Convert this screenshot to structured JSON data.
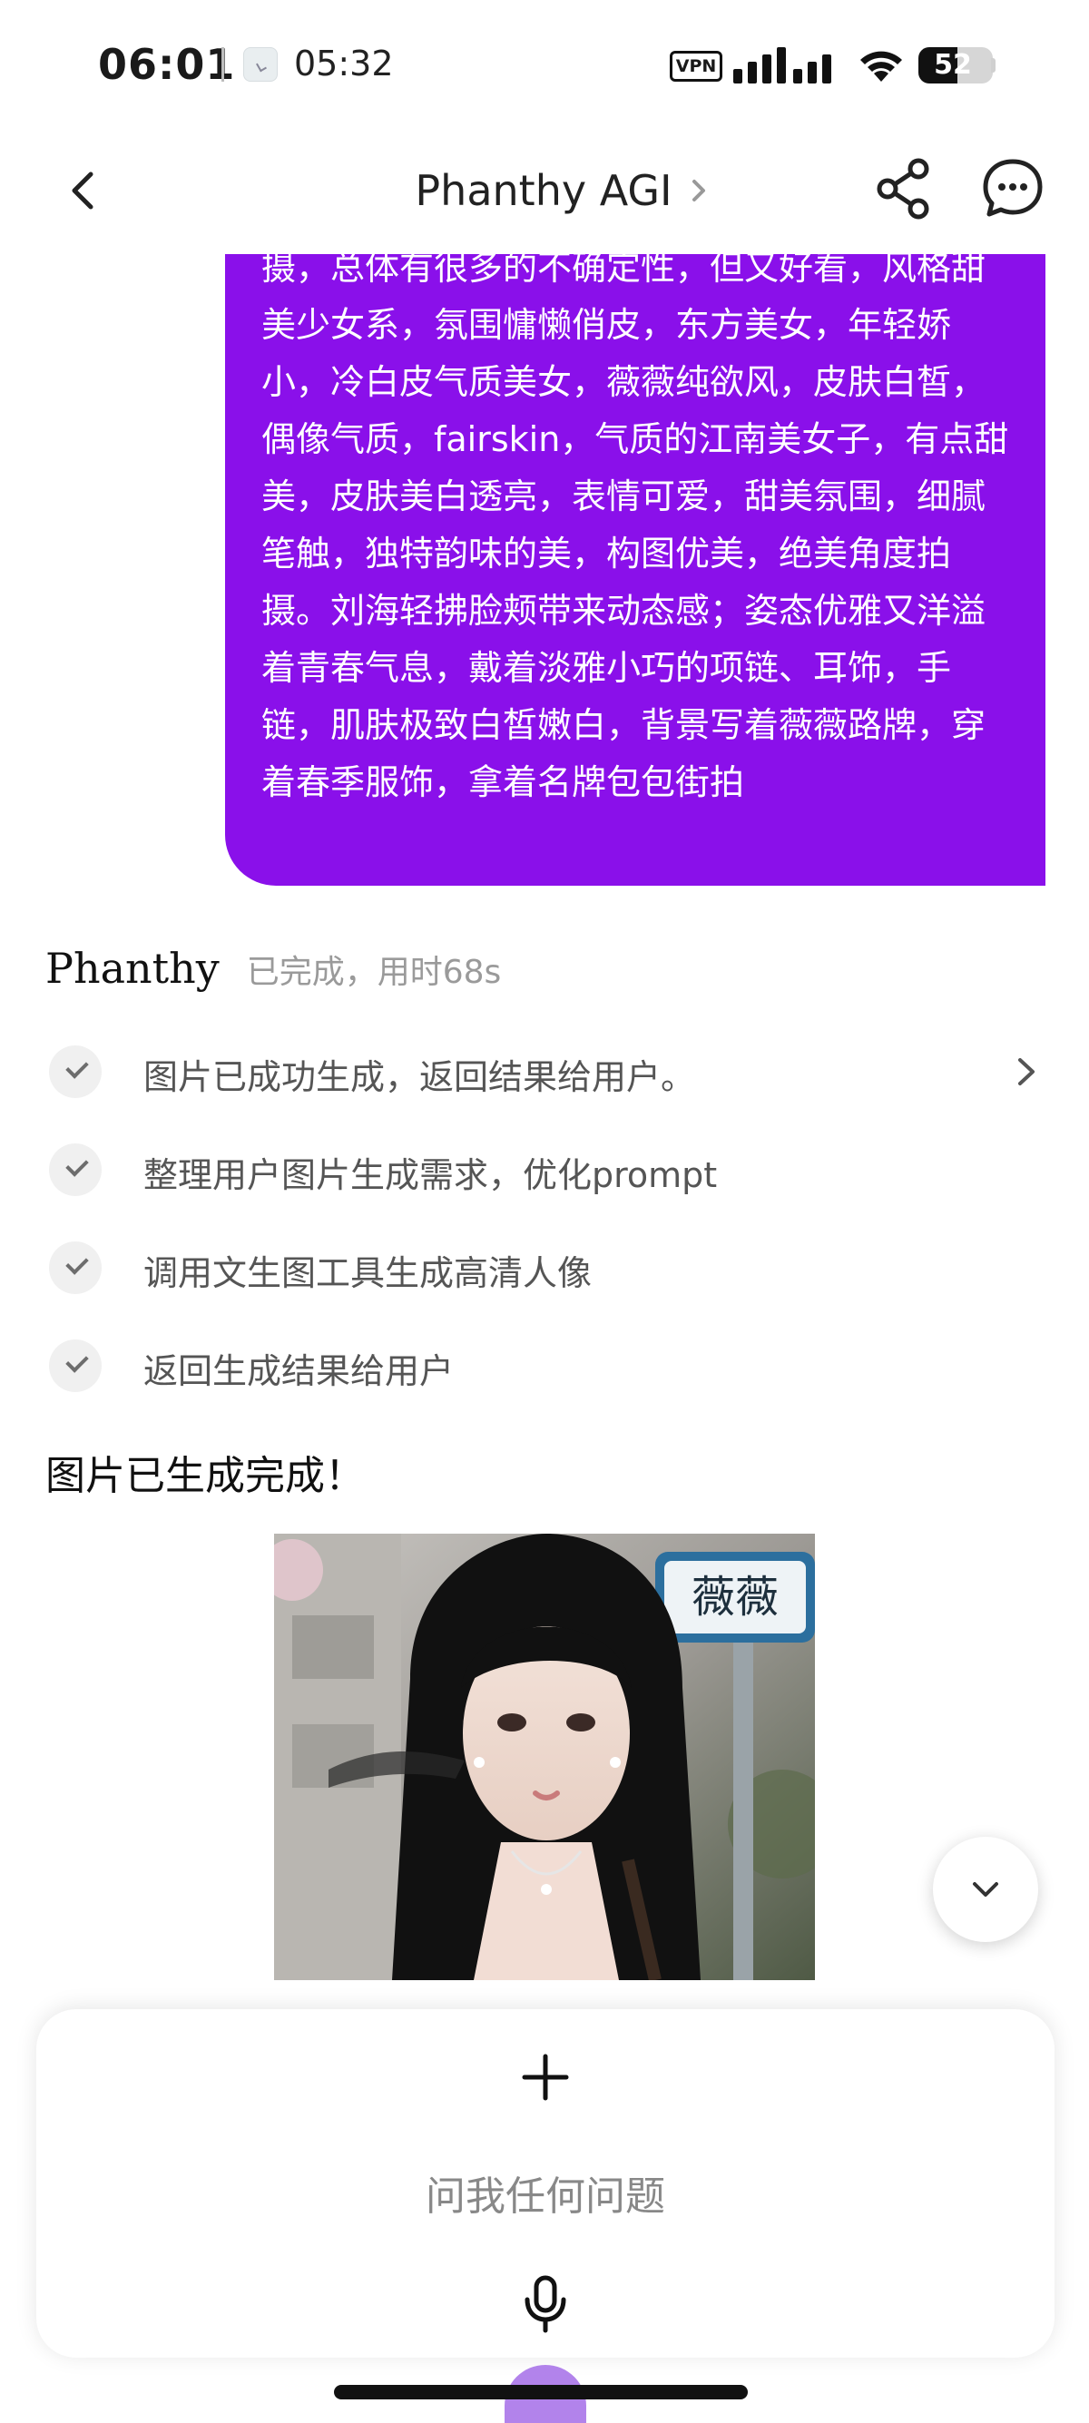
{
  "status_bar": {
    "time": "06:01",
    "secondary_time": "05:32",
    "vpn_label": "VPN",
    "battery_level": "52"
  },
  "header": {
    "title": "Phanthy AGI"
  },
  "user_message": {
    "text": "摄，总体有很多的不确定性，但又好看，风格甜美少女系，氛围慵懒俏皮，东方美女，年轻娇小，冷白皮气质美女，薇薇纯欲风，皮肤白皙，偶像气质，fairskin，气质的江南美女子，有点甜美，皮肤美白透亮，表情可爱，甜美氛围，细腻笔触，独特韵味的美，构图优美，绝美角度拍摄。刘海轻拂脸颊带来动态感；姿态优雅又洋溢着青春气息，戴着淡雅小巧的项链、耳饰，手链，肌肤极致白皙嫩白，背景写着薇薇路牌，穿着春季服饰，拿着名牌包包街拍",
    "bubble_color": "#8a10ea"
  },
  "agent": {
    "name": "Phanthy",
    "status": "已完成，用时68s",
    "steps": [
      {
        "label": "图片已成功生成，返回结果给用户。"
      },
      {
        "label": "整理用户图片生成需求，优化prompt"
      },
      {
        "label": "调用文生图工具生成高清人像"
      },
      {
        "label": "返回生成结果给用户"
      }
    ],
    "result_text": "图片已生成完成！",
    "image_sign_text": "薇薇"
  },
  "composer": {
    "placeholder": "问我任何问题"
  },
  "icons": {
    "back": "chevron-left-icon",
    "title_more": "chevron-right-icon",
    "share": "share-icon",
    "chat": "chat-bubble-icon",
    "step_check": "check-icon",
    "expand_step": "chevron-right-icon",
    "scroll_down": "chevron-down-icon",
    "add": "plus-icon",
    "voice": "microphone-icon"
  }
}
